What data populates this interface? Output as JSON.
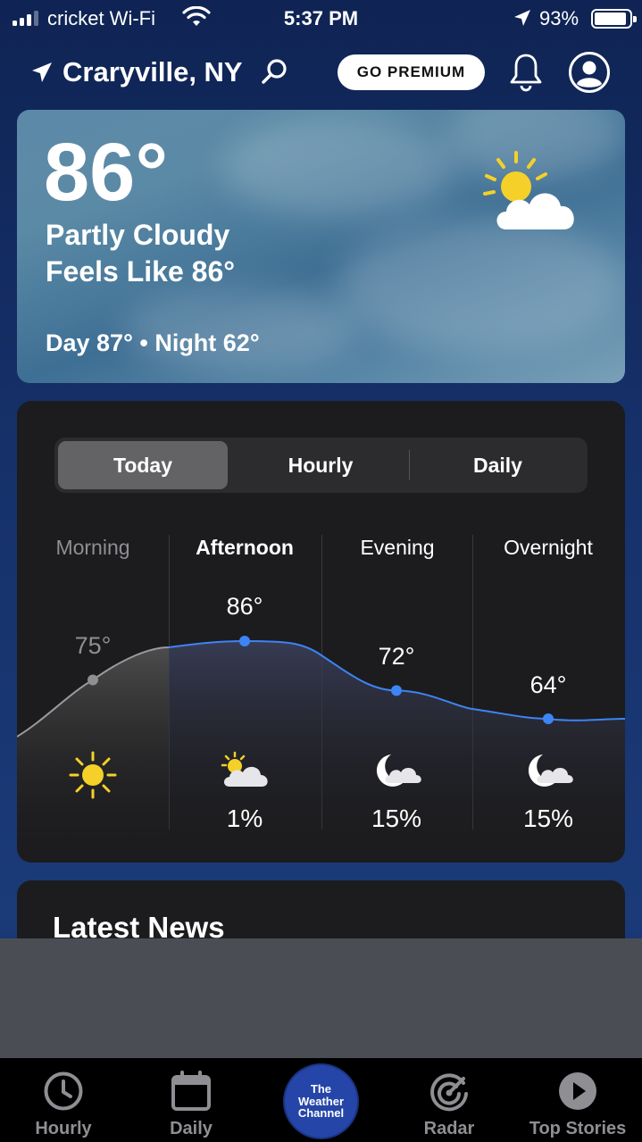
{
  "status_bar": {
    "carrier": "cricket Wi-Fi",
    "time": "5:37 PM",
    "battery": "93%",
    "battery_level": 0.93
  },
  "header": {
    "location": "Craryville, NY",
    "premium_button": "GO PREMIUM"
  },
  "current": {
    "temperature": "86°",
    "condition": "Partly Cloudy",
    "feels_like": "Feels Like 86°",
    "day_night": "Day 87° • Night 62°",
    "icon": "partly-cloudy-icon"
  },
  "forecast": {
    "tabs": [
      "Today",
      "Hourly",
      "Daily"
    ],
    "active_tab": "Today",
    "periods": [
      {
        "label": "Morning",
        "temp": "75°",
        "temp_value": 75,
        "icon": "sun-icon",
        "precip": ""
      },
      {
        "label": "Afternoon",
        "temp": "86°",
        "temp_value": 86,
        "icon": "partly-cloudy-icon",
        "precip": "1%"
      },
      {
        "label": "Evening",
        "temp": "72°",
        "temp_value": 72,
        "icon": "moon-cloud-icon",
        "precip": "15%"
      },
      {
        "label": "Overnight",
        "temp": "64°",
        "temp_value": 64,
        "icon": "moon-cloud-icon",
        "precip": "15%"
      }
    ]
  },
  "news": {
    "title": "Latest News"
  },
  "tab_bar": {
    "items": [
      "Hourly",
      "Daily",
      "Radar",
      "Top Stories"
    ],
    "logo_lines": [
      "The",
      "Weather",
      "Channel"
    ]
  },
  "colors": {
    "background": "#13285a",
    "accent_blue": "#3d84f5",
    "card": "#1c1c1e",
    "sun": "#f5d028"
  }
}
